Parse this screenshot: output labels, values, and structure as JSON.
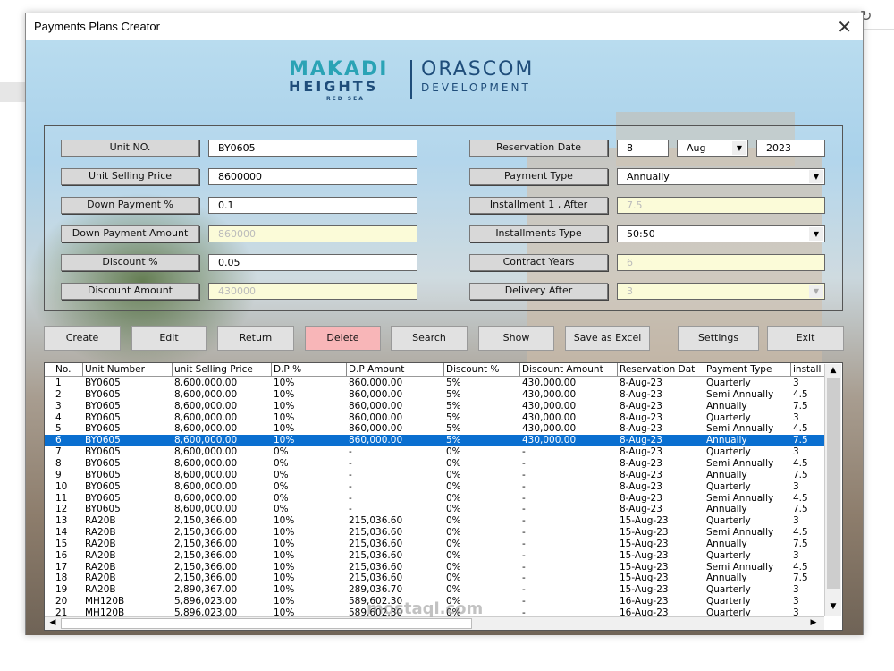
{
  "window": {
    "title": "Payments Plans Creator"
  },
  "logo": {
    "left_line1": "MAKADI",
    "left_line2": "HEIGHTS",
    "left_line3": "RED SEA",
    "right_line1": "ORASCOM",
    "right_line2": "DEVELOPMENT"
  },
  "form": {
    "unit_no": {
      "label": "Unit NO.",
      "value": "BY0605"
    },
    "unit_price": {
      "label": "Unit Selling Price",
      "value": "8600000"
    },
    "dp_pct": {
      "label": "Down Payment %",
      "value": "0.1"
    },
    "dp_amount": {
      "label": "Down Payment Amount",
      "value": "860000"
    },
    "discount_pct": {
      "label": "Discount %",
      "value": "0.05"
    },
    "discount_amount": {
      "label": "Discount Amount",
      "value": "430000"
    },
    "reservation_date": {
      "label": "Reservation Date",
      "day": "8",
      "month": "Aug",
      "year": "2023"
    },
    "payment_type": {
      "label": "Payment Type",
      "value": "Annually"
    },
    "installment_after": {
      "label": "Installment 1 , After",
      "value": "7.5"
    },
    "installments_type": {
      "label": "Installments Type",
      "value": "50:50"
    },
    "contract_years": {
      "label": "Contract Years",
      "value": "6"
    },
    "delivery_after": {
      "label": "Delivery After",
      "value": "3"
    }
  },
  "buttons": {
    "create": "Create",
    "edit": "Edit",
    "return": "Return",
    "delete": "Delete",
    "search": "Search",
    "show": "Show",
    "save_excel": "Save as Excel",
    "settings": "Settings",
    "exit": "Exit"
  },
  "colors": {
    "delete_button": "#f8b6b8",
    "selected_row": "#0a6fd0"
  },
  "table": {
    "selected_row": 6,
    "columns": [
      "No.",
      "Unit Number",
      "unit Selling Price",
      "D.P %",
      "D.P Amount",
      "Discount %",
      "Discount Amount",
      "Reservation Dat",
      "Payment Type",
      "install"
    ],
    "rows": [
      [
        "1",
        "BY0605",
        "8,600,000.00",
        "10%",
        "860,000.00",
        "5%",
        "430,000.00",
        "8-Aug-23",
        "Quarterly",
        "3"
      ],
      [
        "2",
        "BY0605",
        "8,600,000.00",
        "10%",
        "860,000.00",
        "5%",
        "430,000.00",
        "8-Aug-23",
        "Semi Annually",
        "4.5"
      ],
      [
        "3",
        "BY0605",
        "8,600,000.00",
        "10%",
        "860,000.00",
        "5%",
        "430,000.00",
        "8-Aug-23",
        "Annually",
        "7.5"
      ],
      [
        "4",
        "BY0605",
        "8,600,000.00",
        "10%",
        "860,000.00",
        "5%",
        "430,000.00",
        "8-Aug-23",
        "Quarterly",
        "3"
      ],
      [
        "5",
        "BY0605",
        "8,600,000.00",
        "10%",
        "860,000.00",
        "5%",
        "430,000.00",
        "8-Aug-23",
        "Semi Annually",
        "4.5"
      ],
      [
        "6",
        "BY0605",
        "8,600,000.00",
        "10%",
        "860,000.00",
        "5%",
        "430,000.00",
        "8-Aug-23",
        "Annually",
        "7.5"
      ],
      [
        "7",
        "BY0605",
        "8,600,000.00",
        "0%",
        "-",
        "0%",
        "-",
        "8-Aug-23",
        "Quarterly",
        "3"
      ],
      [
        "8",
        "BY0605",
        "8,600,000.00",
        "0%",
        "-",
        "0%",
        "-",
        "8-Aug-23",
        "Semi Annually",
        "4.5"
      ],
      [
        "9",
        "BY0605",
        "8,600,000.00",
        "0%",
        "-",
        "0%",
        "-",
        "8-Aug-23",
        "Annually",
        "7.5"
      ],
      [
        "10",
        "BY0605",
        "8,600,000.00",
        "0%",
        "-",
        "0%",
        "-",
        "8-Aug-23",
        "Quarterly",
        "3"
      ],
      [
        "11",
        "BY0605",
        "8,600,000.00",
        "0%",
        "-",
        "0%",
        "-",
        "8-Aug-23",
        "Semi Annually",
        "4.5"
      ],
      [
        "12",
        "BY0605",
        "8,600,000.00",
        "0%",
        "-",
        "0%",
        "-",
        "8-Aug-23",
        "Annually",
        "7.5"
      ],
      [
        "13",
        "RA20B",
        "2,150,366.00",
        "10%",
        "215,036.60",
        "0%",
        "-",
        "15-Aug-23",
        "Quarterly",
        "3"
      ],
      [
        "14",
        "RA20B",
        "2,150,366.00",
        "10%",
        "215,036.60",
        "0%",
        "-",
        "15-Aug-23",
        "Semi Annually",
        "4.5"
      ],
      [
        "15",
        "RA20B",
        "2,150,366.00",
        "10%",
        "215,036.60",
        "0%",
        "-",
        "15-Aug-23",
        "Annually",
        "7.5"
      ],
      [
        "16",
        "RA20B",
        "2,150,366.00",
        "10%",
        "215,036.60",
        "0%",
        "-",
        "15-Aug-23",
        "Quarterly",
        "3"
      ],
      [
        "17",
        "RA20B",
        "2,150,366.00",
        "10%",
        "215,036.60",
        "0%",
        "-",
        "15-Aug-23",
        "Semi Annually",
        "4.5"
      ],
      [
        "18",
        "RA20B",
        "2,150,366.00",
        "10%",
        "215,036.60",
        "0%",
        "-",
        "15-Aug-23",
        "Annually",
        "7.5"
      ],
      [
        "19",
        "RA20B",
        "2,890,367.00",
        "10%",
        "289,036.70",
        "0%",
        "-",
        "15-Aug-23",
        "Quarterly",
        "3"
      ],
      [
        "20",
        "MH120B",
        "5,896,023.00",
        "10%",
        "589,602.30",
        "0%",
        "-",
        "16-Aug-23",
        "Quarterly",
        "3"
      ],
      [
        "21",
        "MH120B",
        "5,896,023.00",
        "10%",
        "589,602.30",
        "0%",
        "-",
        "16-Aug-23",
        "Quarterly",
        "3"
      ]
    ]
  },
  "watermark": "mostaql.com"
}
